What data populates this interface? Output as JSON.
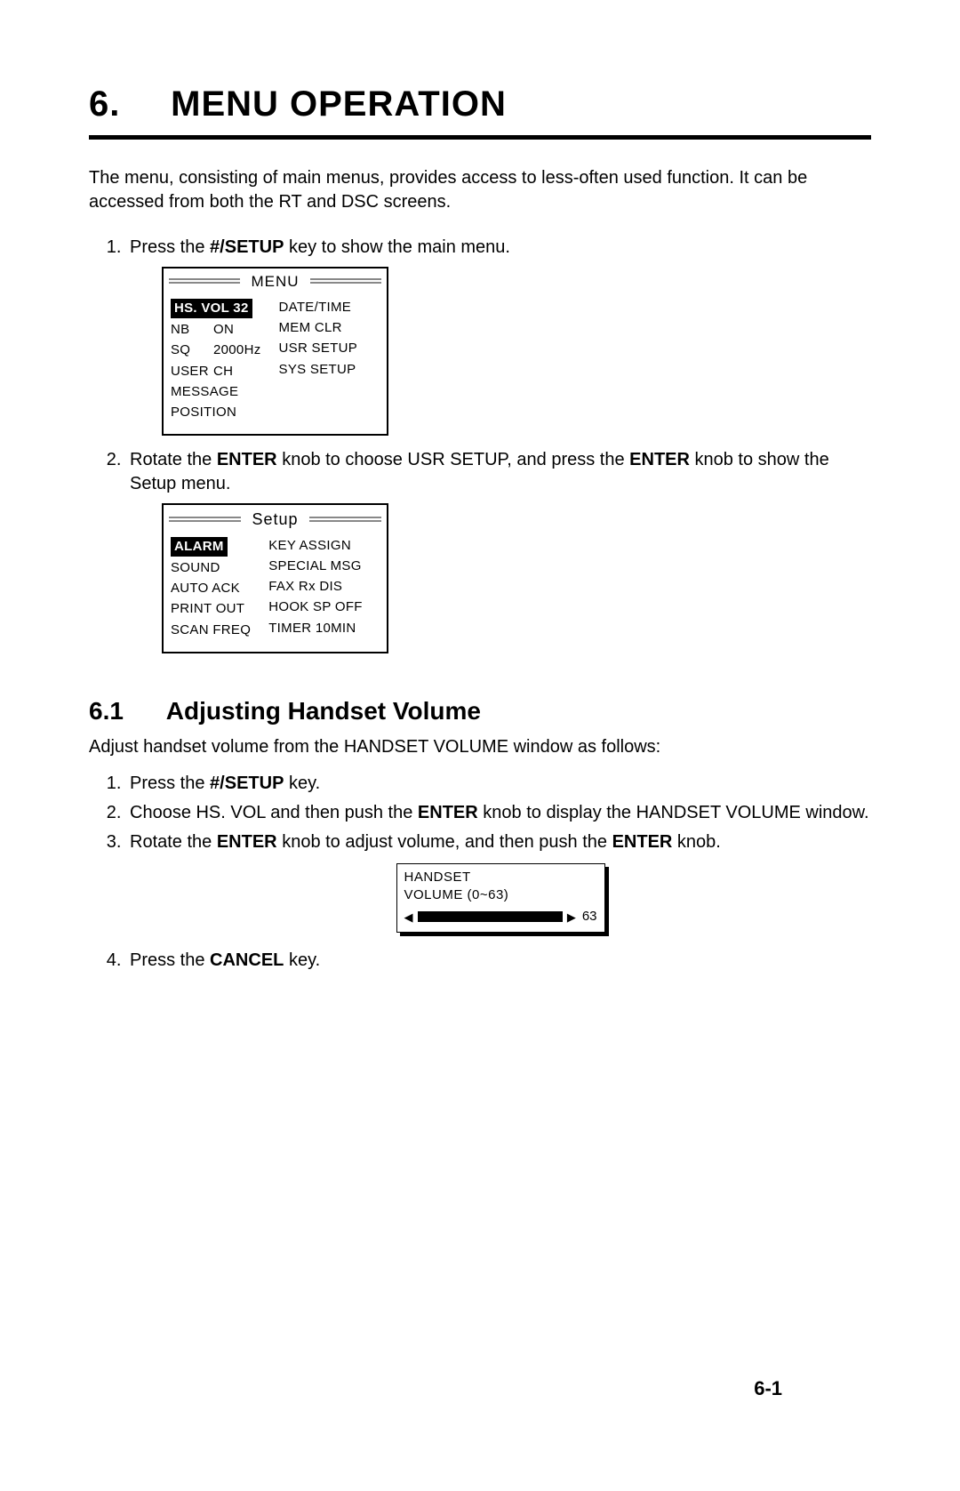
{
  "chapter": {
    "num": "6.",
    "title": "MENU OPERATION"
  },
  "intro": "The menu, consisting of main menus, provides access to less-often used function. It can be accessed from both the RT and DSC screens.",
  "main_steps": {
    "s1_pre": "Press the ",
    "s1_key": "#/SETUP",
    "s1_post": " key to show the main menu.",
    "s2_a": "Rotate the ",
    "s2_b": "ENTER",
    "s2_c": " knob to choose USR SETUP, and press the ",
    "s2_d": "ENTER",
    "s2_e": " knob to show the Setup menu."
  },
  "menu_screen": {
    "title": "MENU",
    "left": {
      "selected": "HS. VOL 32",
      "rows": [
        {
          "k": "NB",
          "v": "ON"
        },
        {
          "k": "SQ",
          "v": "2000Hz"
        },
        {
          "k": "USER",
          "v": "CH"
        }
      ],
      "simple": [
        "MESSAGE",
        "POSITION"
      ]
    },
    "right": [
      "DATE/TIME",
      "MEM CLR",
      "USR SETUP",
      "SYS SETUP"
    ]
  },
  "setup_screen": {
    "title": "Setup",
    "left": {
      "selected": "ALARM",
      "rows": [
        "SOUND",
        "AUTO ACK",
        "PRINT OUT",
        "SCAN FREQ"
      ]
    },
    "right": [
      "KEY ASSIGN",
      "SPECIAL MSG",
      "FAX Rx DIS",
      "HOOK SP OFF",
      "TIMER 10MIN"
    ]
  },
  "section": {
    "num": "6.1",
    "title": "Adjusting Handset Volume"
  },
  "section_intro": "Adjust handset volume from the HANDSET VOLUME window as follows:",
  "hv_steps": {
    "s1_a": "Press the ",
    "s1_b": "#/SETUP",
    "s1_c": " key.",
    "s2_a": "Choose HS. VOL and then push the ",
    "s2_b": "ENTER",
    "s2_c": " knob to display the HANDSET VOLUME window.",
    "s3_a": "Rotate the ",
    "s3_b": "ENTER",
    "s3_c": " knob to adjust volume, and then push the ",
    "s3_d": "ENTER",
    "s3_e": " knob.",
    "s4_a": "Press the ",
    "s4_b": "CANCEL",
    "s4_c": " key."
  },
  "hv_window": {
    "line1": "HANDSET",
    "line2": "VOLUME (0~63)",
    "left_arrow": "◀",
    "right_arrow": "▶",
    "value": "63"
  },
  "page_number": "6-1"
}
